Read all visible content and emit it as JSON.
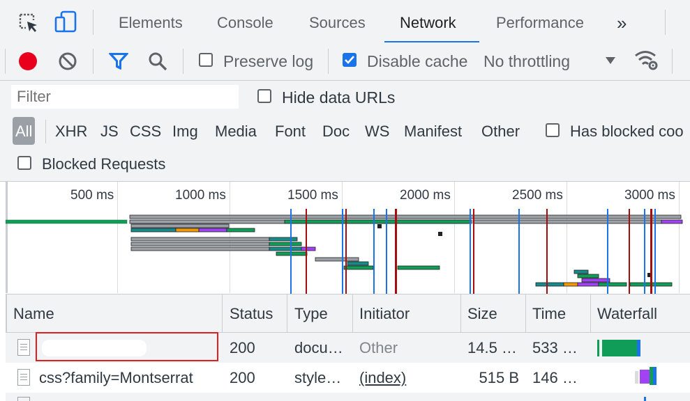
{
  "tabs": [
    {
      "label": "Elements"
    },
    {
      "label": "Console"
    },
    {
      "label": "Sources"
    },
    {
      "label": "Network",
      "active": true
    },
    {
      "label": "Performance"
    }
  ],
  "tab_overflow_glyph": "»",
  "toolbar": {
    "preserve_log": "Preserve log",
    "disable_cache": "Disable cache",
    "throttling": "No throttling"
  },
  "filter": {
    "placeholder": "Filter",
    "hide_data_urls": "Hide data URLs",
    "types": [
      "All",
      "XHR",
      "JS",
      "CSS",
      "Img",
      "Media",
      "Font",
      "Doc",
      "WS",
      "Manifest",
      "Other"
    ],
    "has_blocked_cookies": "Has blocked coo",
    "blocked_requests": "Blocked Requests"
  },
  "overview": {
    "ticks": [
      "500 ms",
      "1000 ms",
      "1500 ms",
      "2000 ms",
      "2500 ms",
      "3000 ms"
    ]
  },
  "columns": [
    "Name",
    "Status",
    "Type",
    "Initiator",
    "Size",
    "Time",
    "Waterfall"
  ],
  "rows": [
    {
      "name": "",
      "status": "200",
      "type": "docu…",
      "initiator": "Other",
      "size": "14.5 …",
      "time": "533 …"
    },
    {
      "name": "css?family=Montserrat",
      "status": "200",
      "type": "style…",
      "initiator": "(index)",
      "size": "515 B",
      "time": "146 …"
    }
  ],
  "colors": {
    "accent": "#1a73e8",
    "record": "#e8001c",
    "highlight": "#e02020"
  }
}
